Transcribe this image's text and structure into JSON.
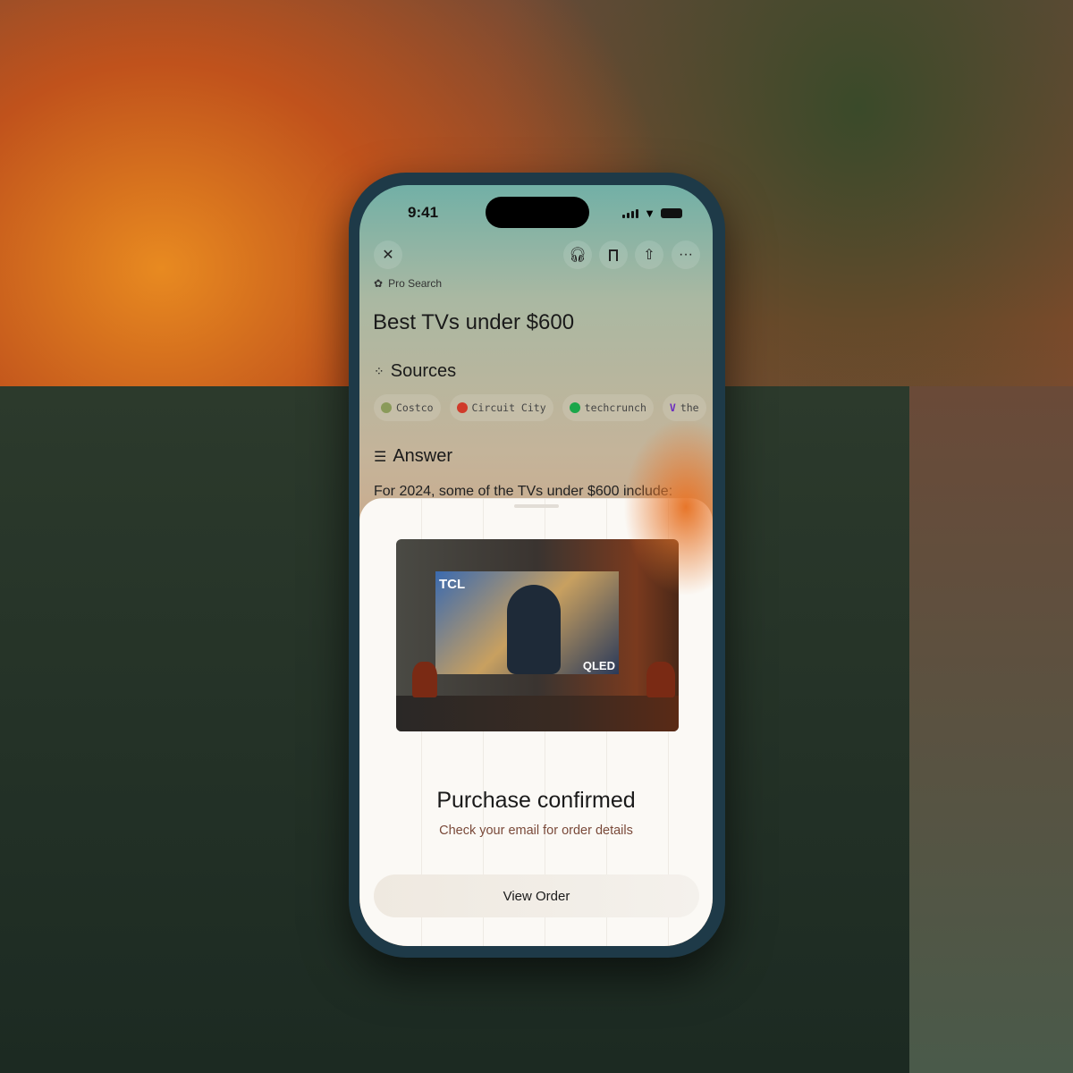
{
  "status_bar": {
    "time": "9:41"
  },
  "toolbar": {
    "close_icon": "close-icon",
    "actions": [
      "headphones-icon",
      "bookmark-icon",
      "share-icon",
      "more-icon"
    ]
  },
  "badge": "Pro Search",
  "query_title": "Best TVs under $600",
  "sources": {
    "heading": "Sources",
    "items": [
      {
        "label": "Costco",
        "color": "#8a9a5a"
      },
      {
        "label": "Circuit City",
        "color": "#d03a2a"
      },
      {
        "label": "techcrunch",
        "color": "#1aa64a"
      },
      {
        "label": "the",
        "color": "#6a2ac0"
      }
    ]
  },
  "answer": {
    "heading": "Answer",
    "text": "For 2024, some of the TVs under $600 include:"
  },
  "sheet": {
    "product_image_text": [
      "TCL",
      "QLED"
    ],
    "title": "Purchase confirmed",
    "subtitle": "Check your email for order details",
    "button": "View Order",
    "subtitle_color": "#7a4a3a"
  }
}
